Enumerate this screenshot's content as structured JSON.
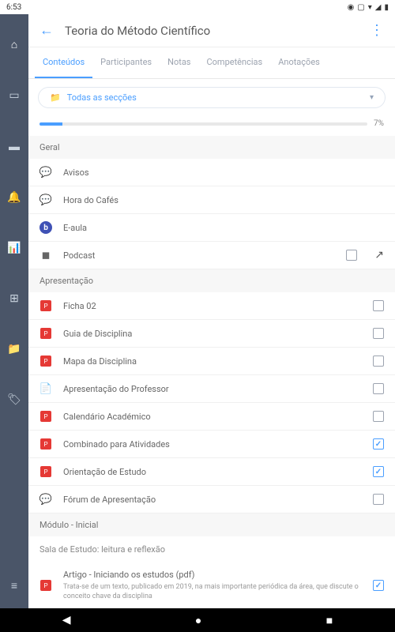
{
  "status": {
    "time": "6:53",
    "icons": [
      "▾",
      "◢",
      "▮"
    ]
  },
  "page": {
    "title": "Teoria do Método Científico"
  },
  "tabs": [
    {
      "label": "Conteúdos",
      "active": true
    },
    {
      "label": "Participantes",
      "active": false
    },
    {
      "label": "Notas",
      "active": false
    },
    {
      "label": "Competências",
      "active": false
    },
    {
      "label": "Anotações",
      "active": false
    }
  ],
  "filter": {
    "label": "Todas as secções"
  },
  "progress": {
    "pct": "7%"
  },
  "sections": [
    {
      "title": "Geral",
      "items": [
        {
          "icon": "forum",
          "label": "Avisos",
          "checkbox": null
        },
        {
          "icon": "forum",
          "label": "Hora do Cafés",
          "checkbox": null
        },
        {
          "icon": "circle",
          "label": "E-aula",
          "checkbox": null
        },
        {
          "icon": "page",
          "label": "Podcast",
          "checkbox": false,
          "launch": true
        }
      ]
    },
    {
      "title": "Apresentação",
      "items": [
        {
          "icon": "pdf",
          "label": "Ficha 02",
          "checkbox": false
        },
        {
          "icon": "pdf",
          "label": "Guia de Disciplina",
          "checkbox": false
        },
        {
          "icon": "pdf",
          "label": "Mapa da Disciplina",
          "checkbox": false
        },
        {
          "icon": "doc",
          "label": "Apresentação do Professor",
          "checkbox": false
        },
        {
          "icon": "pdf",
          "label": "Calendário Académico",
          "checkbox": false
        },
        {
          "icon": "pdf",
          "label": "Combinado para Atividades",
          "checkbox": true
        },
        {
          "icon": "pdf",
          "label": "Orientação de Estudo",
          "checkbox": true
        },
        {
          "icon": "forum",
          "label": "Fórum de Apresentação",
          "checkbox": false
        }
      ]
    },
    {
      "title": "Módulo - Inicial",
      "placeholder": "Sala de Estudo: leitura e reflexão",
      "items": [
        {
          "icon": "pdf",
          "label": "Artigo - Iniciando os estudos (pdf)",
          "checkbox": true,
          "desc": "Trata-se de um texto, publicado em 2019, na mais importante periódica da área, que discute o conceito chave da disciplina"
        }
      ]
    }
  ]
}
